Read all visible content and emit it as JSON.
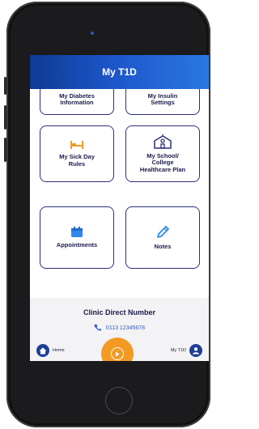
{
  "app": {
    "title": "My T1D"
  },
  "tiles": [
    {
      "id": "diabetes-info",
      "label": "My Diabetes\nInformation",
      "icon": "info-icon"
    },
    {
      "id": "insulin-settings",
      "label": "My Insulin\nSettings",
      "icon": "syringe-icon"
    },
    {
      "id": "sick-day-rules",
      "label": "My Sick Day\nRules",
      "icon": "bed-icon"
    },
    {
      "id": "school-plan",
      "label": "My School/\nCollege\nHealthcare Plan",
      "icon": "school-icon"
    },
    {
      "id": "appointments",
      "label": "Appointments",
      "icon": "calendar-icon"
    },
    {
      "id": "notes",
      "label": "Notes",
      "icon": "pencil-icon"
    }
  ],
  "clinic": {
    "title": "Clinic Direct Number",
    "phone": "0113 12345678",
    "phone_icon": "phone-icon"
  },
  "bottom_nav": {
    "home_label": "Home",
    "me_label": "My T1D",
    "center_icon": "play-icon"
  },
  "colors": {
    "header_start": "#0f3a94",
    "header_end": "#2a78e2",
    "tile_border": "#2d2f78",
    "icon_orange": "#f39a24",
    "icon_blue": "#2d5dc8",
    "accent_orange": "#f39a24",
    "nav_blue": "#1d3f96"
  }
}
